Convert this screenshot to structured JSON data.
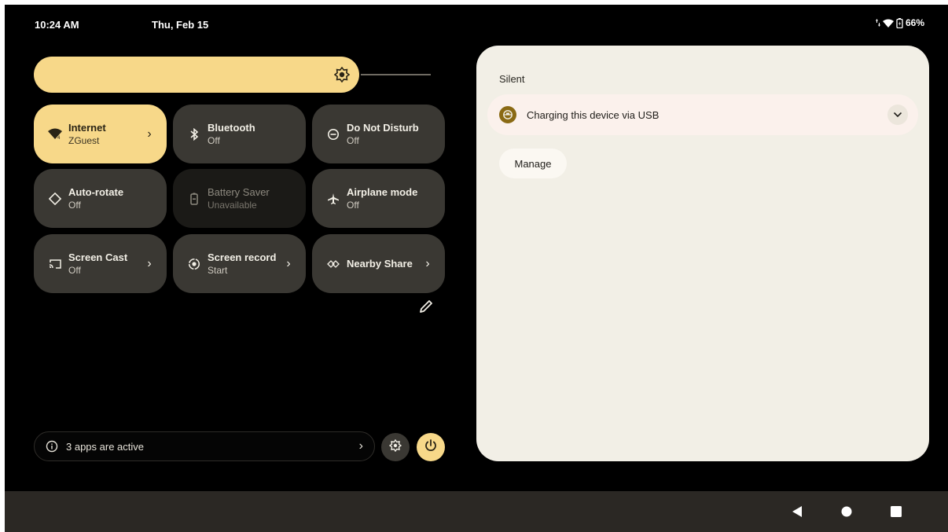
{
  "status_bar": {
    "time": "10:24 AM",
    "date": "Thu, Feb 15",
    "battery_percent": "66%",
    "icons": [
      "data-transfer-icon",
      "wifi-icon",
      "battery-charging-icon"
    ]
  },
  "brightness": {
    "level": 0.82,
    "icon": "brightness-icon"
  },
  "tiles": [
    {
      "title": "Internet",
      "subtitle": "ZGuest",
      "icon": "wifi-icon",
      "state": "active",
      "has_chevron": true
    },
    {
      "title": "Bluetooth",
      "subtitle": "Off",
      "icon": "bluetooth-icon",
      "state": "inactive",
      "has_chevron": false
    },
    {
      "title": "Do Not Disturb",
      "subtitle": "Off",
      "icon": "do-not-disturb-icon",
      "state": "inactive",
      "has_chevron": false
    },
    {
      "title": "Auto-rotate",
      "subtitle": "Off",
      "icon": "auto-rotate-icon",
      "state": "inactive",
      "has_chevron": false
    },
    {
      "title": "Battery Saver",
      "subtitle": "Unavailable",
      "icon": "battery-saver-icon",
      "state": "disabled",
      "has_chevron": false
    },
    {
      "title": "Airplane mode",
      "subtitle": "Off",
      "icon": "airplane-icon",
      "state": "inactive",
      "has_chevron": false
    },
    {
      "title": "Screen Cast",
      "subtitle": "Off",
      "icon": "screen-cast-icon",
      "state": "inactive",
      "has_chevron": true
    },
    {
      "title": "Screen record",
      "subtitle": "Start",
      "icon": "screen-record-icon",
      "state": "inactive",
      "has_chevron": true
    },
    {
      "title": "Nearby Share",
      "subtitle": "",
      "icon": "nearby-share-icon",
      "state": "inactive",
      "has_chevron": true
    }
  ],
  "footer": {
    "active_apps_label": "3 apps are active"
  },
  "notifications": {
    "section_header": "Silent",
    "items": [
      {
        "text": "Charging this device via USB",
        "icon": "usb-icon"
      }
    ],
    "manage_label": "Manage"
  },
  "colors": {
    "accent": "#f7d889",
    "tile_inactive": "#3a3833",
    "panel_bg": "#f2efe6",
    "navbar_bg": "#2b2824"
  },
  "navbar": {
    "buttons": [
      "back-icon",
      "home-icon",
      "recents-icon"
    ]
  }
}
